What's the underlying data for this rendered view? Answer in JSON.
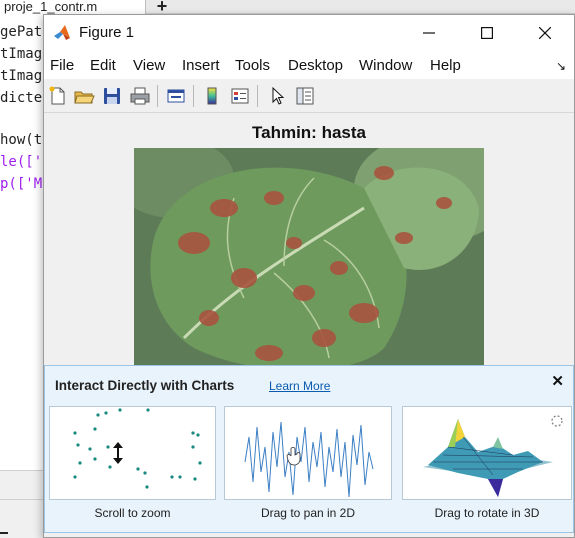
{
  "editor": {
    "tab_label": "proje_1_contr.m",
    "add_tab": "+",
    "lines": [
      "gePat",
      "tImag",
      "tImag",
      "dicte",
      "",
      "how(t",
      "le(['",
      "p(['M"
    ]
  },
  "window": {
    "title": "Figure 1",
    "minimize": "minimize",
    "maximize": "maximize",
    "close": "close"
  },
  "menu": {
    "items": [
      "File",
      "Edit",
      "View",
      "Insert",
      "Tools",
      "Desktop",
      "Window",
      "Help"
    ],
    "dock_arrow": "↘"
  },
  "toolbar": {
    "buttons": [
      "new-figure-icon",
      "open-file-icon",
      "save-icon",
      "print-icon",
      "link-plot-icon",
      "insert-colorbar-icon",
      "insert-legend-icon",
      "edit-plot-icon",
      "property-inspector-icon"
    ]
  },
  "plot": {
    "title": "Tahmin: hasta"
  },
  "info_panel": {
    "title": "Interact Directly with Charts",
    "link": "Learn More",
    "close": "✕",
    "cards": [
      {
        "caption": "Scroll to zoom"
      },
      {
        "caption": "Drag to pan in 2D"
      },
      {
        "caption": "Drag to rotate in 3D"
      }
    ]
  },
  "colors": {
    "accent_blue": "#0a5bb0",
    "panel_bg": "#e8f3fb",
    "panel_border": "#9cc4e4",
    "scatter_teal": "#1a8a80",
    "line_blue": "#3b7fc4"
  }
}
